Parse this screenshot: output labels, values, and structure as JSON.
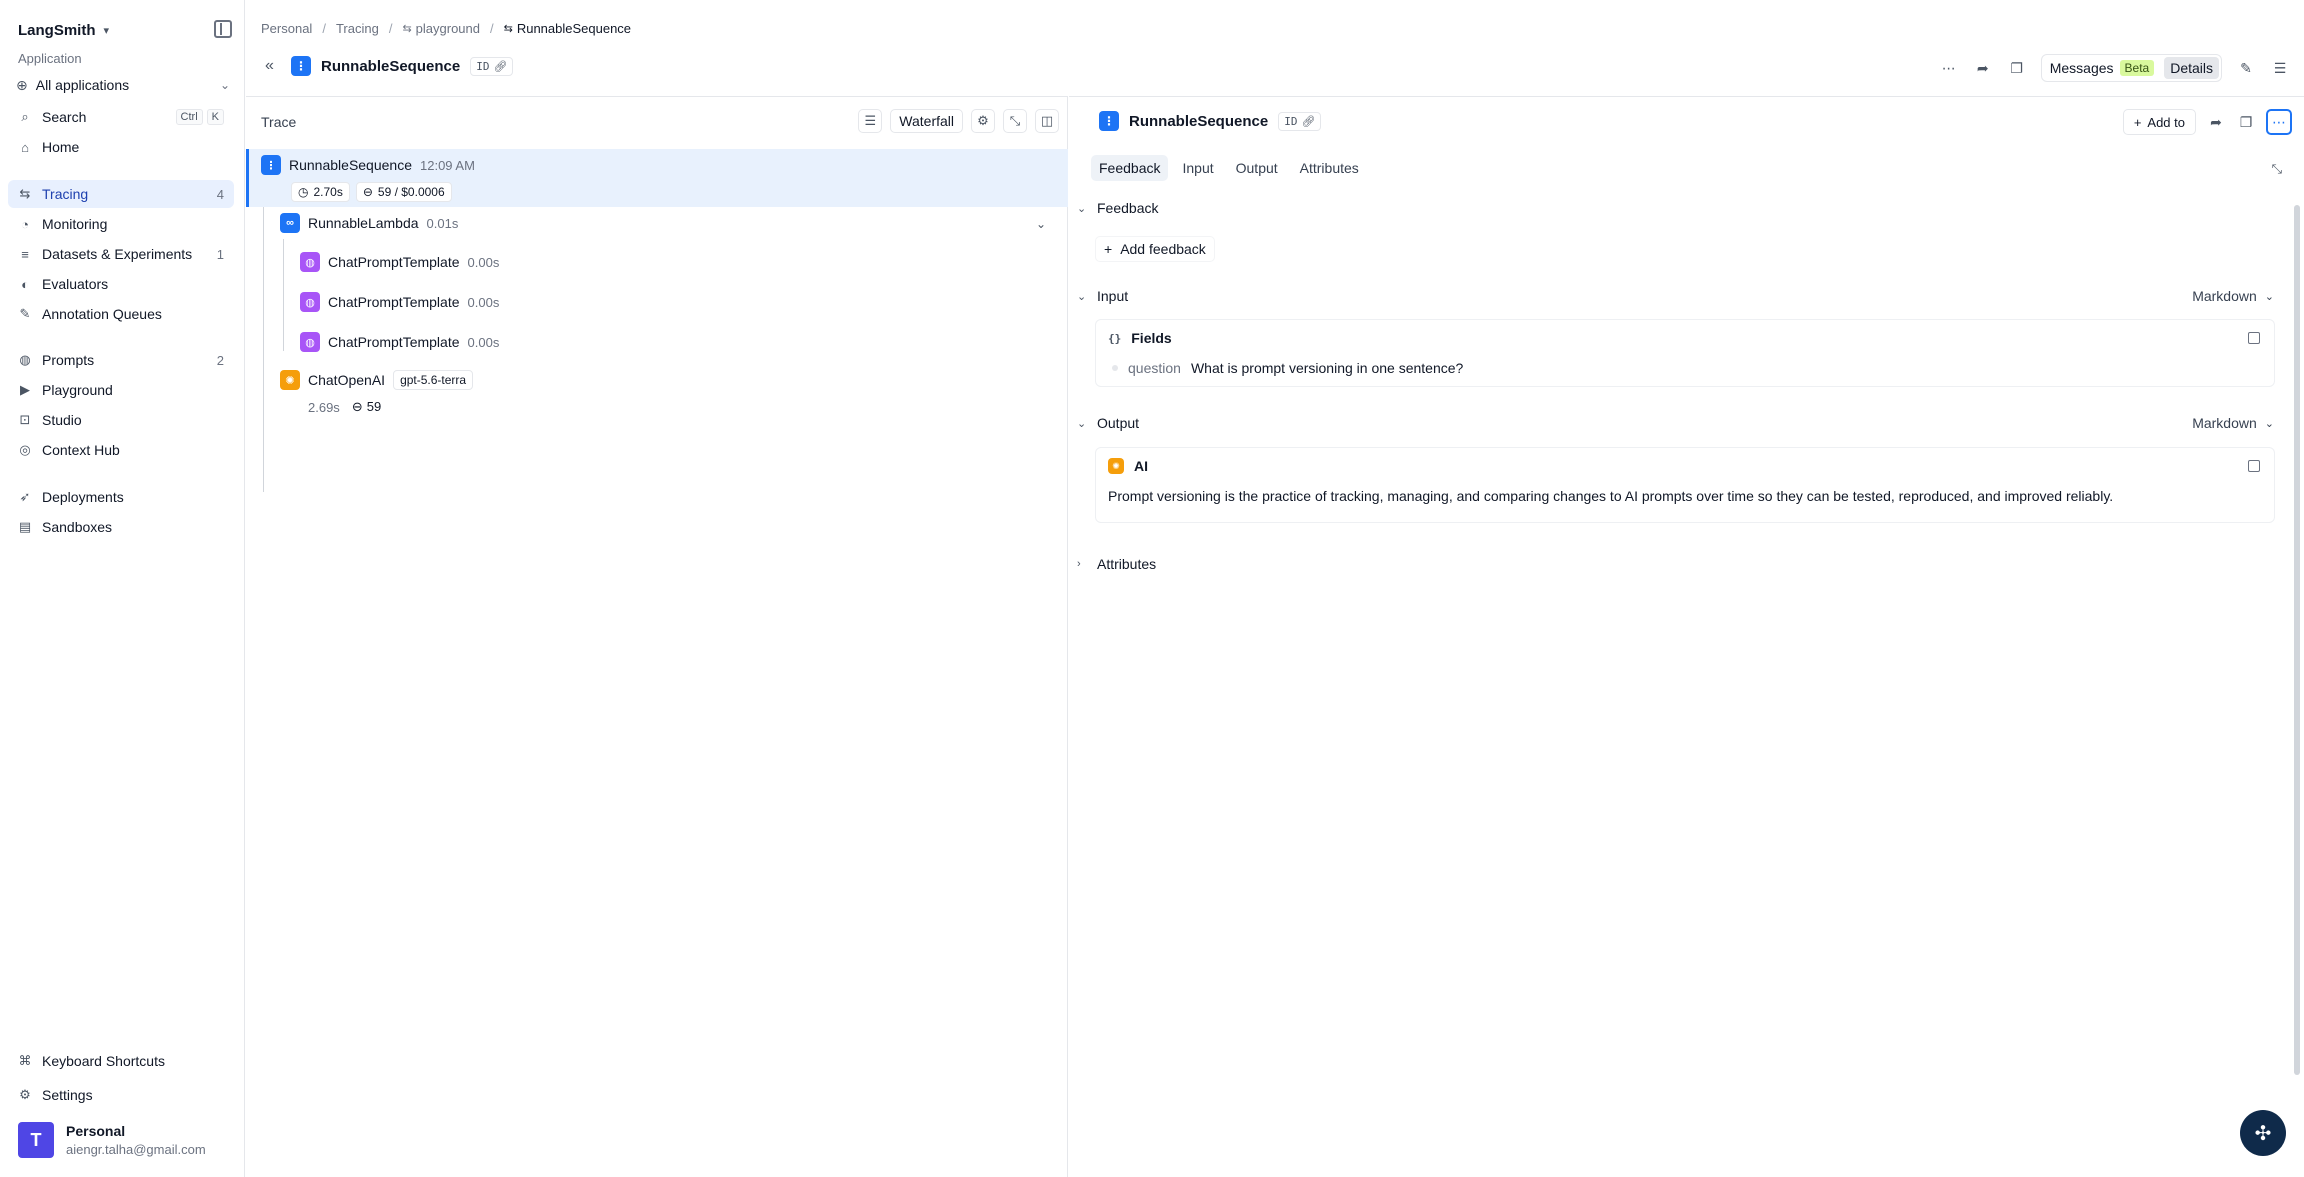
{
  "sidebar": {
    "brand": "LangSmith",
    "app_label": "Application",
    "app_selector": "All applications",
    "search": {
      "label": "Search",
      "key1": "Ctrl",
      "key2": "K"
    },
    "items": [
      {
        "label": "Home",
        "icon": "home-icon",
        "glyph": "⌂"
      },
      {
        "label": "Tracing",
        "icon": "tracing-icon",
        "glyph": "⇆",
        "count": "4"
      },
      {
        "label": "Monitoring",
        "icon": "monitoring-icon",
        "glyph": "◔"
      },
      {
        "label": "Datasets & Experiments",
        "icon": "database-icon",
        "glyph": "≡",
        "count": "1"
      },
      {
        "label": "Evaluators",
        "icon": "evaluators-icon",
        "glyph": "◐"
      },
      {
        "label": "Annotation Queues",
        "icon": "pencil-icon",
        "glyph": "✎"
      },
      {
        "label": "Prompts",
        "icon": "prompts-icon",
        "glyph": "◍",
        "count": "2"
      },
      {
        "label": "Playground",
        "icon": "playground-icon",
        "glyph": "▶"
      },
      {
        "label": "Studio",
        "icon": "studio-icon",
        "glyph": "⊡"
      },
      {
        "label": "Context Hub",
        "icon": "context-hub-icon",
        "glyph": "◎"
      },
      {
        "label": "Deployments",
        "icon": "rocket-icon",
        "glyph": "➶"
      },
      {
        "label": "Sandboxes",
        "icon": "sandbox-icon",
        "glyph": "▤"
      }
    ],
    "keyboard_shortcuts": "Keyboard Shortcuts",
    "settings": "Settings",
    "user": {
      "initial": "T",
      "name": "Personal",
      "email": "aiengr.talha@gmail.com"
    }
  },
  "breadcrumb": [
    "Personal",
    "Tracing",
    "playground",
    "RunnableSequence"
  ],
  "header": {
    "title": "RunnableSequence",
    "id_badge": "ID",
    "messages_label": "Messages",
    "beta_label": "Beta",
    "details_label": "Details"
  },
  "trace": {
    "title": "Trace",
    "waterfall_label": "Waterfall",
    "root": {
      "name": "RunnableSequence",
      "time": "12:09 AM",
      "latency": "2.70s",
      "tokens": "59 / $0.0006"
    },
    "lambda": {
      "name": "RunnableLambda",
      "latency": "0.01s"
    },
    "templates": [
      {
        "name": "ChatPromptTemplate",
        "latency": "0.00s"
      },
      {
        "name": "ChatPromptTemplate",
        "latency": "0.00s"
      },
      {
        "name": "ChatPromptTemplate",
        "latency": "0.00s"
      }
    ],
    "llm": {
      "name": "ChatOpenAI",
      "model": "gpt-5.6-terra",
      "latency": "2.69s",
      "tokens": "59"
    }
  },
  "details": {
    "title": "RunnableSequence",
    "id_badge": "ID",
    "add_to_label": "Add to",
    "tabs": [
      "Feedback",
      "Input",
      "Output",
      "Attributes"
    ],
    "feedback": {
      "title": "Feedback",
      "add_label": "Add feedback"
    },
    "input": {
      "title": "Input",
      "format": "Markdown",
      "card_title": "Fields",
      "field_key": "question",
      "field_value": "What is prompt versioning in one sentence?"
    },
    "output": {
      "title": "Output",
      "format": "Markdown",
      "card_title": "AI",
      "text": "Prompt versioning is the practice of tracking, managing, and comparing changes to AI prompts over time so they can be tested, reproduced, and improved reliably."
    },
    "attributes": {
      "title": "Attributes"
    }
  },
  "colors": {
    "accent": "#1d74f5",
    "active_row": "#e8f1fd",
    "prompt": "#a855f7",
    "llm": "#f59e0b",
    "beta": "#d9f99d"
  }
}
